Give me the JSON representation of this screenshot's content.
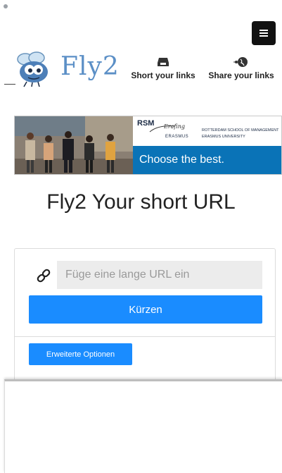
{
  "menu": {
    "icon": "hamburger-icon"
  },
  "header": {
    "logo_text": "Fly2",
    "logo_icon": "fly-mascot-icon",
    "nav": [
      {
        "label": "Short your links",
        "icon": "scissors-box-icon"
      },
      {
        "label": "Share your links",
        "icon": "share-globe-icon"
      }
    ]
  },
  "banner": {
    "brand": "RSM",
    "script_text": "Erafing",
    "erasmus_caps": "ERASMUS",
    "school_line1": "ROTTERDAM SCHOOL OF MANAGEMENT",
    "school_line2": "ERASMUS UNIVERSITY",
    "tagline": "Choose the best.",
    "colors": {
      "band": "#0a73b7"
    }
  },
  "main": {
    "title": "Fly2 Your short URL",
    "url_input": {
      "placeholder": "Füge eine lange URL ein",
      "value": ""
    },
    "shorten_label": "Kürzen",
    "options_label": "Erweiterte Optionen",
    "link_icon": "link-icon"
  },
  "colors": {
    "accent": "#1a8cff",
    "logo": "#5b8fc6"
  }
}
